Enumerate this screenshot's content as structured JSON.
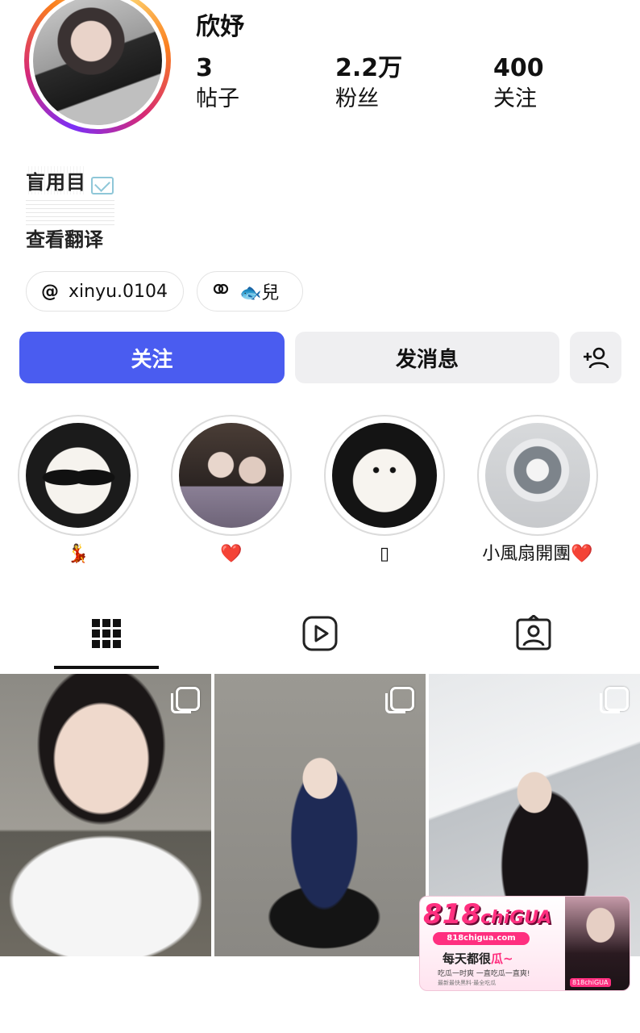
{
  "profile": {
    "username": "欣妤",
    "stats": {
      "posts": {
        "value": "3",
        "label": "帖子"
      },
      "followers": {
        "value": "2.2万",
        "label": "粉丝"
      },
      "following": {
        "value": "400",
        "label": "关注"
      }
    },
    "bio": {
      "text": "盲用目",
      "see_translation": "查看翻译"
    },
    "links": [
      {
        "icon": "threads-icon",
        "label": "xinyu.0104"
      },
      {
        "icon": "link-icon",
        "label": "🐟兒"
      }
    ]
  },
  "actions": {
    "follow_label": "关注",
    "message_label": "发消息",
    "add_user_icon": "add-user-icon"
  },
  "highlights": [
    {
      "label": "💃",
      "image": "white dog with sunglasses"
    },
    {
      "label": "❤️",
      "image": "two girls"
    },
    {
      "label": "▯",
      "image": "white pomeranian"
    },
    {
      "label": "小風扇開團❤️",
      "image": "handheld fan"
    }
  ],
  "tabs": [
    {
      "name": "posts",
      "icon": "grid-icon",
      "active": true
    },
    {
      "name": "reels",
      "icon": "reels-icon",
      "active": false
    },
    {
      "name": "tagged",
      "icon": "tagged-icon",
      "active": false
    }
  ],
  "posts": [
    {
      "type": "carousel",
      "icon": "multi-photo-icon"
    },
    {
      "type": "carousel",
      "icon": "multi-photo-icon"
    },
    {
      "type": "carousel",
      "icon": "multi-photo-icon"
    }
  ],
  "ad_badge": {
    "logo_number": "818",
    "logo_text": "chiGUA",
    "url": "818chigua.com",
    "slogan_prefix": "每天都很",
    "slogan_highlight": "瓜~",
    "tagline": "吃瓜一时爽 一直吃瓜一直爽!",
    "fine_print": "最新最快黑料·最全吃瓜",
    "person_tag": "818chiGUA"
  },
  "colors": {
    "follow_button": "#4a5cf0",
    "secondary_button": "#efeff1",
    "ad_pink": "#ff2f7f"
  }
}
